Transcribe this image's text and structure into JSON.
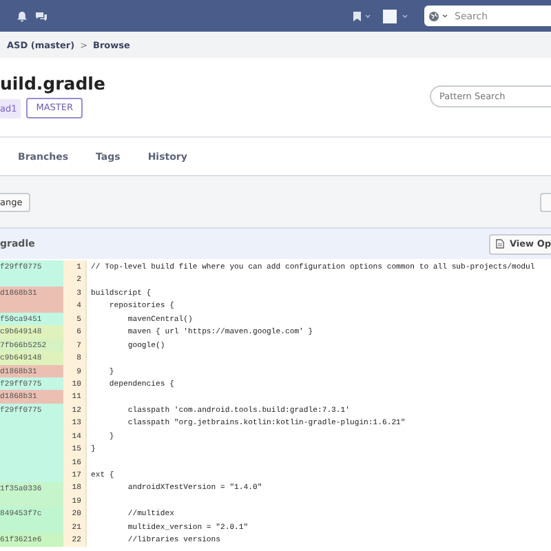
{
  "top_bar": {
    "search": {
      "placeholder": "Search"
    }
  },
  "breadcrumb": [
    "ASD (master)",
    "Browse"
  ],
  "breadcrumb_separator": ">",
  "file": {
    "title": "uild.gradle",
    "commit_badge": "ad1",
    "branch_button": "MASTER",
    "pattern_search": {
      "placeholder": "Pattern Search"
    }
  },
  "tabs": [
    {
      "label": "Branches",
      "selected": false
    },
    {
      "label": "Tags",
      "selected": false
    },
    {
      "label": "History",
      "selected": false
    }
  ],
  "toolbar": {
    "left_button": "ange"
  },
  "code_header": {
    "file_name": "gradle",
    "view_button": "View Op"
  },
  "blame": [
    {
      "commit": "f29ff0775",
      "color": "#c2f7e3",
      "lines": [
        {
          "number": "1",
          "text": "// Top-level build file where you can add configuration options common to all sub-projects/modul"
        },
        {
          "number": "2"
        }
      ]
    },
    {
      "commit": "d1868b31",
      "color": "#ebc0b3",
      "lines": [
        {
          "number": "3",
          "text": "buildscript {"
        },
        {
          "number": "4",
          "text": "    repositories {"
        }
      ]
    },
    {
      "commit": "f50ca9451",
      "color": "#c2f7e3",
      "lines": [
        {
          "number": "5",
          "text": "        mavenCentral()"
        }
      ]
    },
    {
      "commit": "c9b649148",
      "color": "#dff2bc",
      "lines": [
        {
          "number": "6",
          "text": "        maven { url 'https://maven.google.com' }"
        }
      ]
    },
    {
      "commit": "7fb66b5252",
      "color": "#d6f2c2",
      "lines": [
        {
          "number": "7",
          "text": "        google()"
        }
      ]
    },
    {
      "commit": "c9b649148",
      "color": "#dff2bc",
      "lines": [
        {
          "number": "8"
        }
      ]
    },
    {
      "commit": "d1868b31",
      "color": "#ebc0b3",
      "lines": [
        {
          "number": "9",
          "text": "    }"
        }
      ]
    },
    {
      "commit": "f29ff0775",
      "color": "#c2f7e3",
      "lines": [
        {
          "number": "10",
          "text": "    dependencies {"
        }
      ]
    },
    {
      "commit": "d1868b31",
      "color": "#ebc0b3",
      "lines": [
        {
          "number": "11"
        }
      ]
    },
    {
      "commit": "f29ff0775",
      "color": "#c2f7e3",
      "lines": [
        {
          "number": "12",
          "text": "        classpath 'com.android.tools.build:gradle:7.3.1'"
        },
        {
          "number": "13",
          "text": "        classpath \"org.jetbrains.kotlin:kotlin-gradle-plugin:1.6.21\""
        },
        {
          "number": "14",
          "text": "    }"
        },
        {
          "number": "15",
          "text": "}"
        },
        {
          "number": "16"
        },
        {
          "number": "17",
          "text": "ext {"
        }
      ]
    },
    {
      "commit": "1f35a0336",
      "color": "#c6f5cc",
      "lines": [
        {
          "number": "18",
          "text": "        androidXTestVersion = \"1.4.0\""
        },
        {
          "number": "19"
        }
      ]
    },
    {
      "commit": "849453f7c",
      "color": "#bff5cf",
      "lines": [
        {
          "number": "20",
          "text": "        //multidex"
        },
        {
          "number": "21",
          "text": "        multidex_version = \"2.0.1\""
        }
      ]
    },
    {
      "commit": "61f3621e6",
      "color": "#c8f5c0",
      "lines": [
        {
          "number": "22",
          "text": "        //libraries versions"
        }
      ]
    }
  ]
}
